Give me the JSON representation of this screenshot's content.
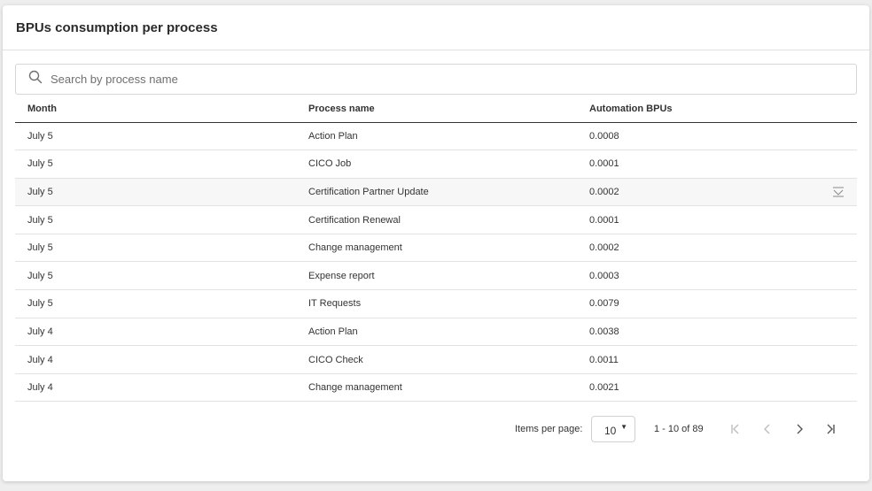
{
  "card": {
    "title": "BPUs consumption per process"
  },
  "search": {
    "placeholder": "Search by process name",
    "value": "",
    "icon": "search-icon"
  },
  "table": {
    "columns": [
      "Month",
      "Process name",
      "Automation BPUs"
    ],
    "rows": [
      {
        "month": "July 5",
        "process": "Action Plan",
        "bpus": "0.0008"
      },
      {
        "month": "July 5",
        "process": "CICO Job",
        "bpus": "0.0001"
      },
      {
        "month": "July 5",
        "process": "Certification Partner Update",
        "bpus": "0.0002"
      },
      {
        "month": "July 5",
        "process": "Certification Renewal",
        "bpus": "0.0001"
      },
      {
        "month": "July 5",
        "process": "Change management",
        "bpus": "0.0002"
      },
      {
        "month": "July 5",
        "process": "Expense report",
        "bpus": "0.0003"
      },
      {
        "month": "July 5",
        "process": "IT Requests",
        "bpus": "0.0079"
      },
      {
        "month": "July 4",
        "process": "Action Plan",
        "bpus": "0.0038"
      },
      {
        "month": "July 4",
        "process": "CICO Check",
        "bpus": "0.0011"
      },
      {
        "month": "July 4",
        "process": "Change management",
        "bpus": "0.0021"
      }
    ],
    "hovered_row_index": 2,
    "row_action_icon": "expand-row-icon"
  },
  "paginator": {
    "items_per_page_label": "Items per page:",
    "items_per_page_value": "10",
    "range_label": "1 - 10 of 89",
    "icons": [
      "first-page-icon",
      "previous-page-icon",
      "next-page-icon",
      "last-page-icon"
    ]
  },
  "colors": {
    "header_border": "#333333",
    "row_border": "#e2e2e2",
    "hover_row": "#f7f7f7",
    "disabled_icon": "#bdbdbd",
    "active_icon": "#555555"
  }
}
